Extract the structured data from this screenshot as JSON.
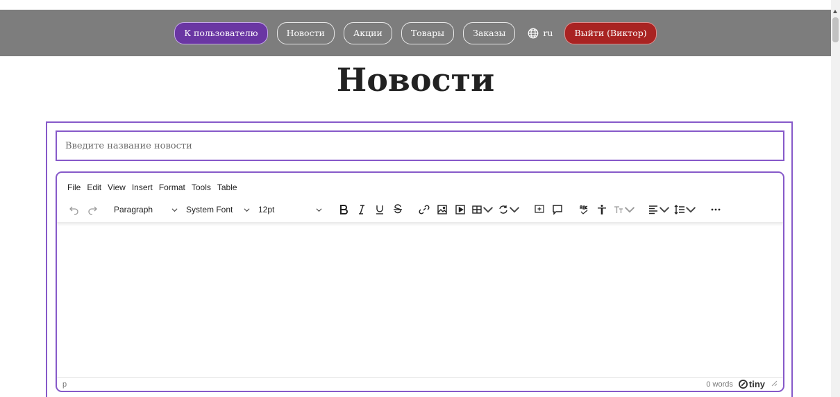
{
  "nav": {
    "user_button": "К пользователю",
    "news_button": "Новости",
    "promos_button": "Акции",
    "products_button": "Товары",
    "orders_button": "Заказы",
    "language": "ru",
    "logout_button": "Выйти (Виктор)"
  },
  "page": {
    "title": "Новости"
  },
  "form": {
    "title_placeholder": "Введите название новости"
  },
  "editor": {
    "menu": [
      "File",
      "Edit",
      "View",
      "Insert",
      "Format",
      "Tools",
      "Table"
    ],
    "block_format": "Paragraph",
    "font_family": "System Font",
    "font_size": "12pt",
    "status_path": "p",
    "word_count": "0 words",
    "brand": "tiny"
  },
  "colors": {
    "accent": "#8659c9",
    "primary_button": "#6a36a3",
    "logout_button": "#a92322",
    "topbar": "#7d7d7d"
  }
}
